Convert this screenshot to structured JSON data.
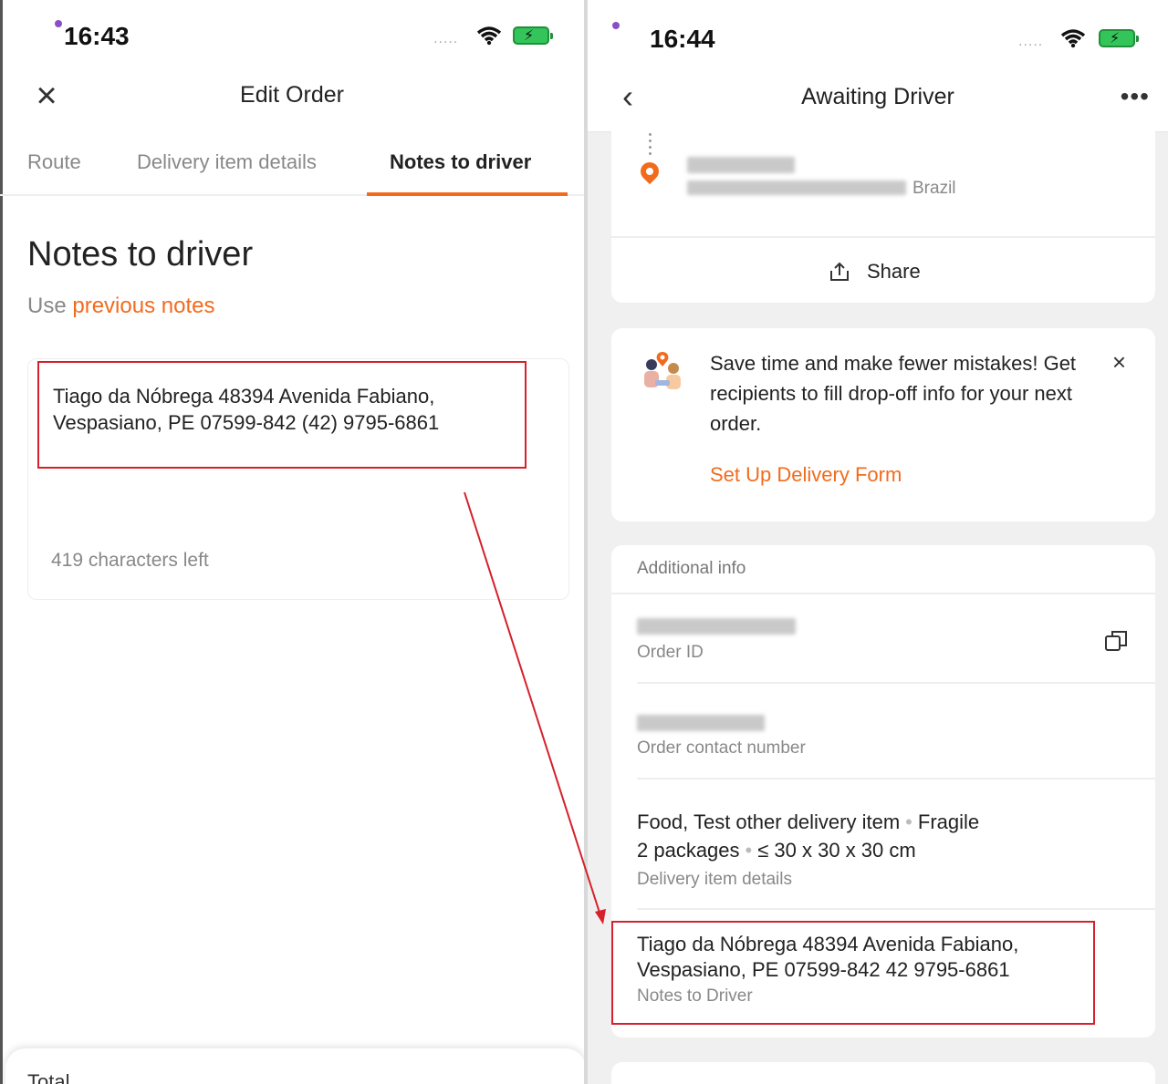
{
  "left": {
    "status": {
      "time": "16:43",
      "signal": "....."
    },
    "header": {
      "close_icon": "close-icon",
      "title": "Edit Order"
    },
    "tabs": [
      {
        "label": "Route"
      },
      {
        "label": "Delivery item details"
      },
      {
        "label": "Notes to driver"
      }
    ],
    "page_title": "Notes to driver",
    "previous_notes": {
      "prefix": "Use",
      "link": "previous notes"
    },
    "note_text": "Tiago da Nóbrega  48394 Avenida Fabiano,\nVespasiano, PE 07599-842  (42) 9795-6861",
    "chars_left": "419 characters left",
    "bottom_label": "Total"
  },
  "right": {
    "status": {
      "time": "16:44",
      "signal": "....."
    },
    "header": {
      "title": "Awaiting Driver",
      "more": "•••"
    },
    "route_card": {
      "country": "Brazil",
      "share_label": "Share"
    },
    "promo": {
      "text": "Save time and make fewer mistakes! Get recipients to fill drop-off info for your next order.",
      "cta": "Set Up Delivery Form",
      "close": "×"
    },
    "additional_info": {
      "title": "Additional info",
      "order_id_label": "Order ID",
      "contact_label": "Order contact number",
      "items_line1_a": "Food, Test other delivery item",
      "items_line1_b": "Fragile",
      "items_line2_a": "2 packages",
      "items_line2_b": "≤ 30 x 30 x 30 cm",
      "items_label": "Delivery item details",
      "notes_text": "Tiago da Nóbrega  48394 Avenida Fabiano,\nVespasiano, PE 07599-842  42 9795-6861",
      "notes_label": "Notes to Driver"
    }
  },
  "colors": {
    "accent": "#f26b1d",
    "highlight": "#d6202b"
  }
}
